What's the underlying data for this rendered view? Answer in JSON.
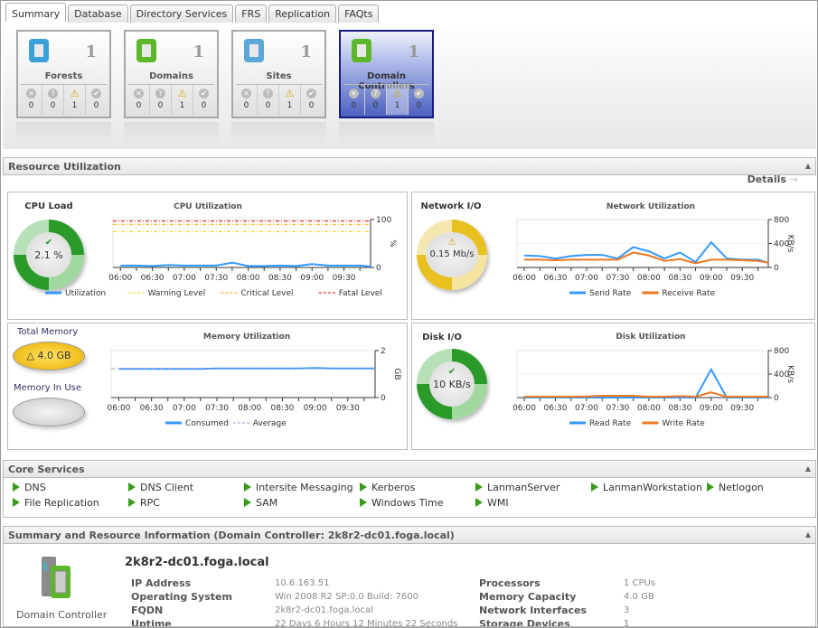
{
  "tabs": [
    "Summary",
    "Database",
    "Directory Services",
    "FRS",
    "Replication",
    "FAQts"
  ],
  "tiles": [
    {
      "name": "Forests",
      "count": "1",
      "stats": [
        "0",
        "0",
        "1",
        "0"
      ],
      "icon": "forest-icon"
    },
    {
      "name": "Domains",
      "count": "1",
      "stats": [
        "0",
        "0",
        "1",
        "0"
      ],
      "icon": "domain-icon"
    },
    {
      "name": "Sites",
      "count": "1",
      "stats": [
        "0",
        "0",
        "1",
        "0"
      ],
      "icon": "sites-icon"
    },
    {
      "name": "Domain Controllers",
      "count": "1",
      "stats": [
        "0",
        "0",
        "1",
        "0"
      ],
      "icon": "domain-controller-icon",
      "selected": true
    }
  ],
  "resource": {
    "title": "Resource Utilization",
    "details": "Details",
    "cpu": {
      "label": "CPU Load",
      "value": "2.1 %",
      "status": "ok"
    },
    "network": {
      "label": "Network I/O",
      "value": "0.15 Mb/s",
      "status": "warning"
    },
    "memory": {
      "total_label": "Total Memory",
      "total_value": "4.0 GB",
      "in_use_label": "Memory In Use"
    },
    "disk": {
      "label": "Disk I/O",
      "value": "10 KB/s",
      "status": "ok"
    }
  },
  "chart_data": [
    {
      "type": "line",
      "title": "CPU Utilization",
      "ylabel": "%",
      "ylim": [
        0,
        100
      ],
      "yticks": [
        "0",
        "100"
      ],
      "x": [
        "06:00",
        "06:15",
        "06:30",
        "06:45",
        "07:00",
        "07:15",
        "07:30",
        "07:45",
        "08:00",
        "08:15",
        "08:30",
        "08:45",
        "09:00",
        "09:15",
        "09:30",
        "09:45",
        "09:55"
      ],
      "xticks": [
        "06:00",
        "06:30",
        "07:00",
        "07:30",
        "08:00",
        "08:30",
        "09:00",
        "09:30"
      ],
      "series": [
        {
          "name": "Utilization",
          "color": "#3399ff",
          "values": [
            4,
            4,
            3,
            5,
            4,
            4,
            4,
            10,
            3,
            3,
            4,
            3,
            7,
            4,
            4,
            4,
            2
          ]
        },
        {
          "name": "Warning Level",
          "color": "#f0d000",
          "dash": true,
          "constant": 75
        },
        {
          "name": "Critical Level",
          "color": "#ff9900",
          "dash": true,
          "constant": 90
        },
        {
          "name": "Fatal Level",
          "color": "#dd0000",
          "dash": true,
          "constant": 97
        }
      ]
    },
    {
      "type": "line",
      "title": "Network Utilization",
      "ylabel": "KB/s",
      "ylim": [
        0,
        800
      ],
      "yticks": [
        "0",
        "400",
        "800"
      ],
      "x": [
        "06:00",
        "06:15",
        "06:30",
        "06:45",
        "07:00",
        "07:15",
        "07:30",
        "07:45",
        "08:00",
        "08:15",
        "08:30",
        "08:45",
        "09:00",
        "09:15",
        "09:30",
        "09:45",
        "09:55"
      ],
      "xticks": [
        "06:00",
        "06:30",
        "07:00",
        "07:30",
        "08:00",
        "08:30",
        "09:00",
        "09:30"
      ],
      "series": [
        {
          "name": "Send Rate",
          "color": "#3399ff",
          "values": [
            200,
            190,
            150,
            190,
            210,
            210,
            150,
            340,
            270,
            150,
            250,
            90,
            420,
            150,
            130,
            130,
            80
          ]
        },
        {
          "name": "Receive Rate",
          "color": "#ee7722",
          "values": [
            130,
            130,
            120,
            130,
            130,
            130,
            130,
            250,
            200,
            110,
            140,
            70,
            130,
            130,
            120,
            110,
            80
          ]
        }
      ]
    },
    {
      "type": "line",
      "title": "Memory Utilization",
      "ylabel": "GB",
      "ylim": [
        0,
        2
      ],
      "yticks": [
        "0",
        "2"
      ],
      "x": [
        "06:00",
        "06:15",
        "06:30",
        "06:45",
        "07:00",
        "07:15",
        "07:30",
        "07:45",
        "08:00",
        "08:15",
        "08:30",
        "08:45",
        "09:00",
        "09:15",
        "09:30",
        "09:45",
        "09:55"
      ],
      "xticks": [
        "06:00",
        "06:30",
        "07:00",
        "07:30",
        "08:00",
        "08:30",
        "09:00",
        "09:30"
      ],
      "series": [
        {
          "name": "Consumed",
          "color": "#3399ff",
          "values": [
            1.22,
            1.22,
            1.22,
            1.22,
            1.22,
            1.22,
            1.24,
            1.24,
            1.24,
            1.24,
            1.24,
            1.24,
            1.26,
            1.24,
            1.24,
            1.24,
            1.24
          ]
        },
        {
          "name": "Average",
          "color": "#9999bb",
          "dash": true,
          "constant": 1.23
        }
      ]
    },
    {
      "type": "line",
      "title": "Disk Utilization",
      "ylabel": "KB/s",
      "ylim": [
        0,
        800
      ],
      "yticks": [
        "0",
        "400",
        "800"
      ],
      "x": [
        "06:00",
        "06:15",
        "06:30",
        "06:45",
        "07:00",
        "07:15",
        "07:30",
        "07:45",
        "08:00",
        "08:15",
        "08:30",
        "08:45",
        "09:00",
        "09:15",
        "09:30",
        "09:45",
        "09:55"
      ],
      "xticks": [
        "06:00",
        "06:30",
        "07:00",
        "07:30",
        "08:00",
        "08:30",
        "09:00",
        "09:30"
      ],
      "series": [
        {
          "name": "Read Rate",
          "color": "#3399ff",
          "values": [
            0,
            0,
            0,
            0,
            0,
            0,
            0,
            0,
            0,
            0,
            0,
            0,
            480,
            0,
            0,
            0,
            0
          ]
        },
        {
          "name": "Write Rate",
          "color": "#ee7722",
          "values": [
            15,
            15,
            15,
            15,
            20,
            30,
            30,
            30,
            15,
            15,
            25,
            15,
            90,
            15,
            15,
            15,
            15
          ]
        }
      ]
    }
  ],
  "core_services": {
    "title": "Core Services",
    "items": [
      "DNS",
      "DNS Client",
      "Intersite Messaging",
      "Kerberos",
      "LanmanServer",
      "LanmanWorkstation",
      "Netlogon",
      "File Replication",
      "RPC",
      "SAM",
      "Windows Time",
      "WMI"
    ]
  },
  "summary": {
    "title": "Summary and Resource Information (Domain Controller: 2k8r2-dc01.foga.local)",
    "host": "2k8r2-dc01.foga.local",
    "icon_label": "Domain Controller",
    "left": [
      {
        "label": "IP Address",
        "value": "10.6.163.51"
      },
      {
        "label": "Operating System",
        "value": "Win 2008 R2 SP:0.0 Build: 7600"
      },
      {
        "label": "FQDN",
        "value": "2k8r2-dc01.foga.local"
      },
      {
        "label": "Uptime",
        "value": "22 Days 6 Hours 12 Minutes 22 Seconds"
      }
    ],
    "right": [
      {
        "label": "Processors",
        "value": "1 CPUs"
      },
      {
        "label": "Memory Capacity",
        "value": "4.0 GB"
      },
      {
        "label": "Network Interfaces",
        "value": "3"
      },
      {
        "label": "Storage Devices",
        "value": "1"
      }
    ]
  }
}
